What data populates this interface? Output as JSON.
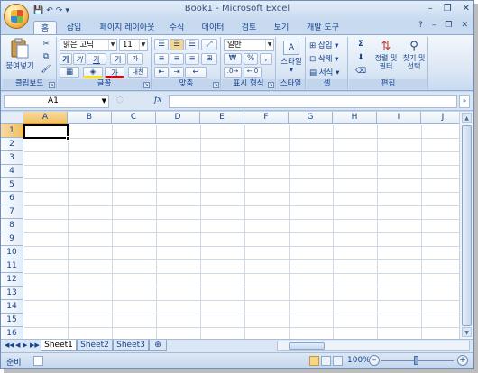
{
  "window": {
    "title": "Book1 - Microsoft Excel",
    "minimize": "–",
    "restore": "❐",
    "close": "✕"
  },
  "qat": {
    "save": "💾",
    "undo": "↶",
    "redo": "↷",
    "customize": "▾"
  },
  "tabs": [
    "홈",
    "삽입",
    "페이지 레이아웃",
    "수식",
    "데이터",
    "검토",
    "보기",
    "개발 도구"
  ],
  "ribbon_controls": {
    "help": "?",
    "min": "–",
    "restore": "❐",
    "close": "✕"
  },
  "ribbon": {
    "clipboard": {
      "label": "클립보드",
      "paste": "붙여넣기"
    },
    "font": {
      "label": "글꼴",
      "name": "맑은 고딕",
      "size": "11",
      "bold": "가",
      "italic": "가",
      "underline": "가",
      "grow": "가",
      "shrink": "가",
      "phonetic": "내천"
    },
    "alignment": {
      "label": "맞춤"
    },
    "number": {
      "label": "표시 형식",
      "format": "일반",
      "currency": "₩",
      "percent": "%",
      "comma": ","
    },
    "styles": {
      "label": "스타일",
      "button": "스타일"
    },
    "cells": {
      "label": "셀",
      "insert": "삽입",
      "delete": "삭제",
      "format": "서식"
    },
    "editing": {
      "label": "편집",
      "sum": "Σ",
      "sort": "정렬 및\n필터",
      "find": "찾기 및\n선택"
    }
  },
  "formula_bar": {
    "name_box": "A1",
    "fx": "fx",
    "value": ""
  },
  "columns": [
    "A",
    "B",
    "C",
    "D",
    "E",
    "F",
    "G",
    "H",
    "I",
    "J"
  ],
  "rows": [
    "1",
    "2",
    "3",
    "4",
    "5",
    "6",
    "7",
    "8",
    "9",
    "10",
    "11",
    "12",
    "13",
    "14",
    "15",
    "16"
  ],
  "sheets": [
    "Sheet1",
    "Sheet2",
    "Sheet3"
  ],
  "sheet_nav": [
    "◀◀",
    "◀",
    "▶",
    "▶▶"
  ],
  "status": {
    "text": "준비",
    "zoom": "100%",
    "zoom_minus": "–",
    "zoom_plus": "+"
  }
}
